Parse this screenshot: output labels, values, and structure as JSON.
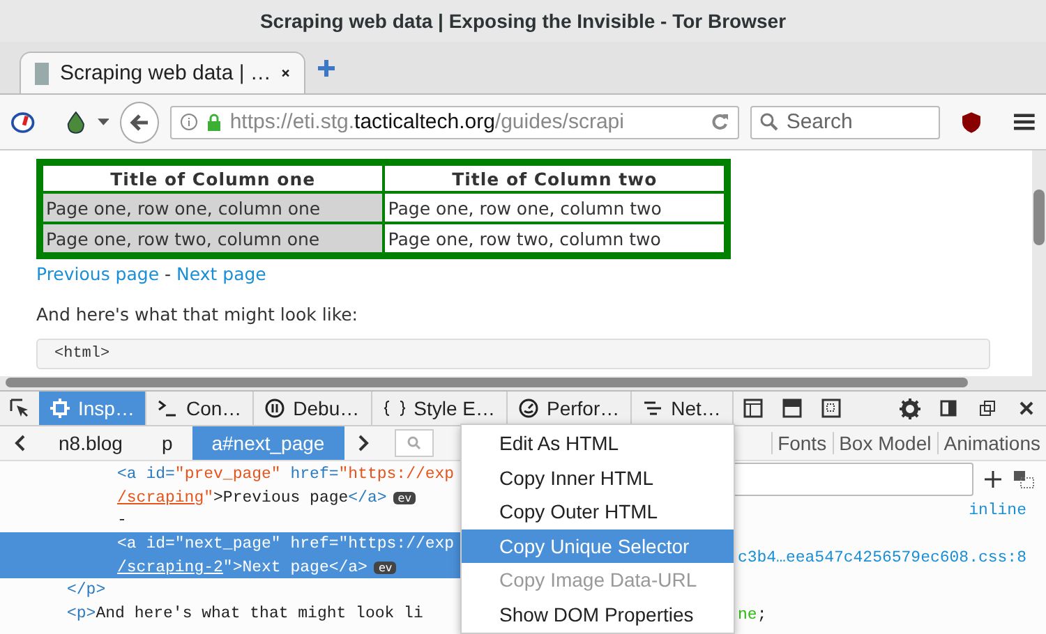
{
  "window": {
    "title": "Scraping web data | Exposing the Invisible - Tor Browser"
  },
  "tabs": [
    {
      "label": "Scraping web data | …",
      "selected": true
    }
  ],
  "nav": {
    "url_prefix": "https://eti.stg.",
    "url_domain": "tacticaltech.org",
    "url_path": "/guides/scrapi",
    "search_placeholder": "Search"
  },
  "page": {
    "table": {
      "columns": [
        "Title of Column one",
        "Title of Column two"
      ],
      "rows": [
        [
          "Page one, row one, column one",
          "Page one, row one, column two"
        ],
        [
          "Page one, row two, column one",
          "Page one, row two, column two"
        ]
      ]
    },
    "links": [
      "Previous page",
      "Next page"
    ],
    "link_separator": "-",
    "paragraph": "And here's what that might look like:",
    "code": "<html>"
  },
  "devtools": {
    "tools": [
      {
        "label": "Insp…",
        "selected": true
      },
      {
        "label": "Con…",
        "selected": false
      },
      {
        "label": "Debu…",
        "selected": false
      },
      {
        "label": "Style E…",
        "selected": false
      },
      {
        "label": "Perfor…",
        "selected": false
      },
      {
        "label": "Net…",
        "selected": false
      }
    ],
    "breadcrumbs": [
      {
        "label": "n8.blog",
        "selected": false
      },
      {
        "label": "p",
        "selected": false
      },
      {
        "label": "a#next_page",
        "selected": true
      }
    ],
    "markup": [
      {
        "kind": "inner",
        "selected": false,
        "tokens": [
          {
            "kind": "tag",
            "text": "<a"
          },
          {
            "kind": "attr",
            "text": " id="
          },
          {
            "kind": "value",
            "text": "\"prev_page\""
          },
          {
            "kind": "attr",
            "text": " href="
          },
          {
            "kind": "value",
            "text": "\"https://exp"
          }
        ]
      },
      {
        "kind": "inner",
        "selected": false,
        "ev": "ev",
        "tokens": [
          {
            "kind": "link",
            "text": "/scraping"
          },
          {
            "kind": "value",
            "text": "\""
          },
          {
            "kind": "text",
            "text": ">Previous page"
          },
          {
            "kind": "tag",
            "text": "</a>"
          }
        ]
      },
      {
        "kind": "inner",
        "selected": false,
        "tokens": [
          {
            "kind": "text",
            "text": "-"
          }
        ]
      },
      {
        "kind": "inner",
        "selected": true,
        "tokens": [
          {
            "kind": "tag",
            "text": "<a"
          },
          {
            "kind": "attr",
            "text": " id="
          },
          {
            "kind": "value",
            "text": "\"next_page\""
          },
          {
            "kind": "attr",
            "text": " href="
          },
          {
            "kind": "value",
            "text": "\"https://exp"
          }
        ]
      },
      {
        "kind": "inner",
        "selected": true,
        "ev": "ev",
        "tokens": [
          {
            "kind": "link",
            "text": "/scraping-2"
          },
          {
            "kind": "value",
            "text": "\""
          },
          {
            "kind": "text",
            "text": ">Next page"
          },
          {
            "kind": "tag",
            "text": "</a>"
          }
        ]
      },
      {
        "kind": "outer",
        "selected": false,
        "tokens": [
          {
            "kind": "tag",
            "text": "</p>"
          }
        ]
      },
      {
        "kind": "outer",
        "selected": false,
        "tokens": [
          {
            "kind": "tag",
            "text": "<p>"
          },
          {
            "kind": "text",
            "text": "And here's what that might look li"
          }
        ]
      }
    ],
    "sidebar_tabs": [
      "Fonts",
      "Box Model",
      "Animations"
    ],
    "rules": {
      "inline": "inline",
      "source": "c3b4…eea547c4256579ec608.css:8",
      "value": "ne",
      "value_end": ";"
    },
    "context_menu": [
      {
        "label": "Edit As HTML",
        "selected": false,
        "disabled": false
      },
      {
        "label": "Copy Inner HTML",
        "selected": false,
        "disabled": false
      },
      {
        "label": "Copy Outer HTML",
        "selected": false,
        "disabled": false
      },
      {
        "label": "Copy Unique Selector",
        "selected": true,
        "disabled": false
      },
      {
        "label": "Copy Image Data-URL",
        "selected": false,
        "disabled": true
      },
      {
        "label": "Show DOM Properties",
        "selected": false,
        "disabled": false
      }
    ]
  }
}
